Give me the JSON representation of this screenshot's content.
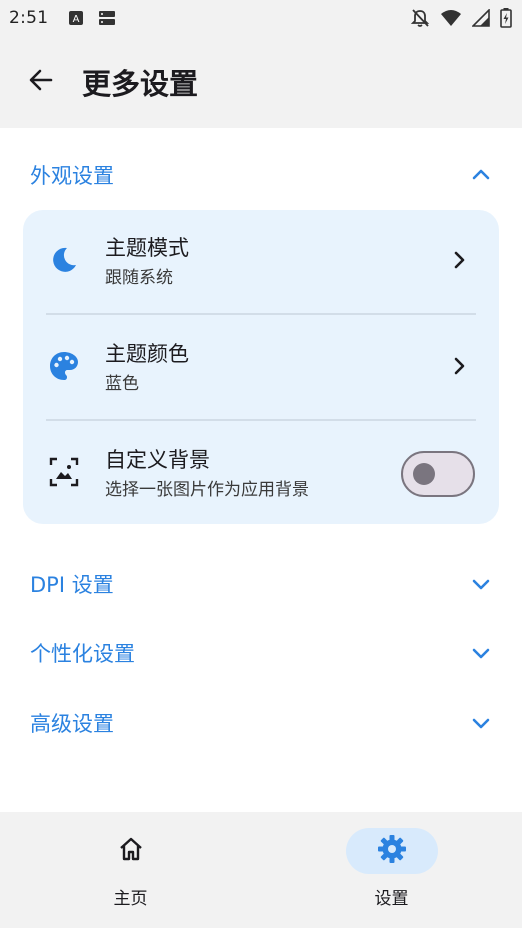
{
  "status_bar": {
    "time": "2:51",
    "left_icons": [
      "a-notification-icon",
      "storage-icon"
    ],
    "right_icons": [
      "bell-off-icon",
      "wifi-icon",
      "signal-icon",
      "battery-charging-icon"
    ]
  },
  "app_bar": {
    "back_icon": "arrow-back-icon",
    "title": "更多设置"
  },
  "sections": {
    "appearance": {
      "label": "外观设置",
      "expanded": true,
      "items": [
        {
          "title": "主题模式",
          "subtitle": "跟随系统",
          "icon": "moon-icon",
          "trailing": "chevron-right-icon"
        },
        {
          "title": "主题颜色",
          "subtitle": "蓝色",
          "icon": "palette-icon",
          "trailing": "chevron-right-icon"
        },
        {
          "title": "自定义背景",
          "subtitle": "选择一张图片作为应用背景",
          "icon": "image-frame-icon",
          "trailing": "switch",
          "switch_on": false
        }
      ]
    },
    "dpi": {
      "label": "DPI 设置",
      "expanded": false
    },
    "personalization": {
      "label": "个性化设置",
      "expanded": false
    },
    "advanced": {
      "label": "高级设置",
      "expanded": false
    }
  },
  "bottom_nav": {
    "items": [
      {
        "label": "主页",
        "icon": "home-icon",
        "active": false
      },
      {
        "label": "设置",
        "icon": "gear-icon",
        "active": true
      }
    ]
  },
  "colors": {
    "accent": "#2b82e0",
    "card_background": "#e8f3fd",
    "bar_background": "#f2f2f2",
    "active_pill": "#d8eafc"
  }
}
